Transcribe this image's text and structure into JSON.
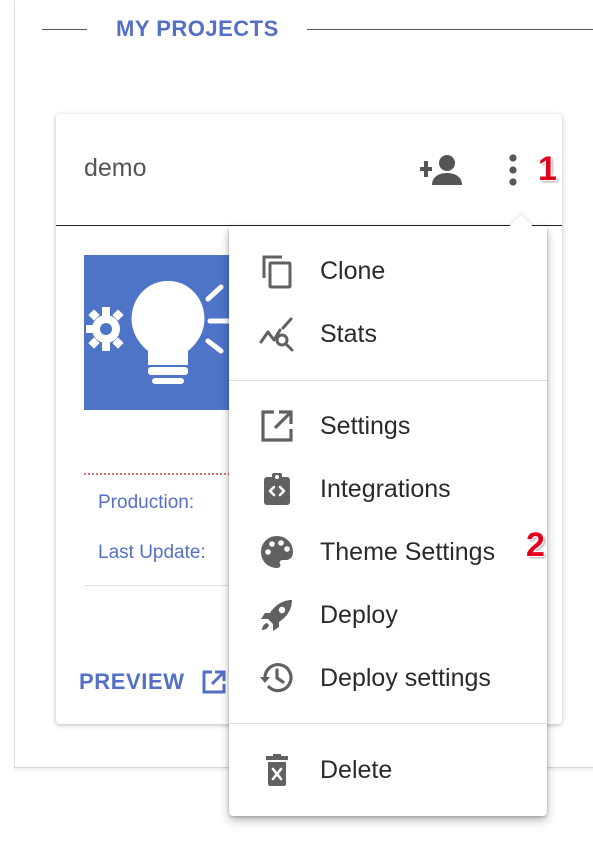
{
  "section": {
    "title": "MY PROJECTS"
  },
  "project": {
    "name": "demo",
    "production_label": "Production:",
    "last_update_label": "Last Update:",
    "preview_label": "PREVIEW"
  },
  "annotations": {
    "marker_1": "1",
    "marker_2": "2"
  },
  "menu": {
    "items": [
      {
        "label": "Clone",
        "icon": "copy-icon"
      },
      {
        "label": "Stats",
        "icon": "stats-search-icon"
      },
      {
        "label": "Settings",
        "icon": "open-in-new-icon"
      },
      {
        "label": "Integrations",
        "icon": "code-clipboard-icon"
      },
      {
        "label": "Theme Settings",
        "icon": "palette-icon"
      },
      {
        "label": "Deploy",
        "icon": "rocket-icon"
      },
      {
        "label": "Deploy settings",
        "icon": "history-icon"
      },
      {
        "label": "Delete",
        "icon": "trash-icon"
      }
    ]
  },
  "colors": {
    "accent": "#5470c6",
    "thumbnail": "#4e74c8",
    "marker": "#e2001a",
    "icon": "#616161"
  }
}
